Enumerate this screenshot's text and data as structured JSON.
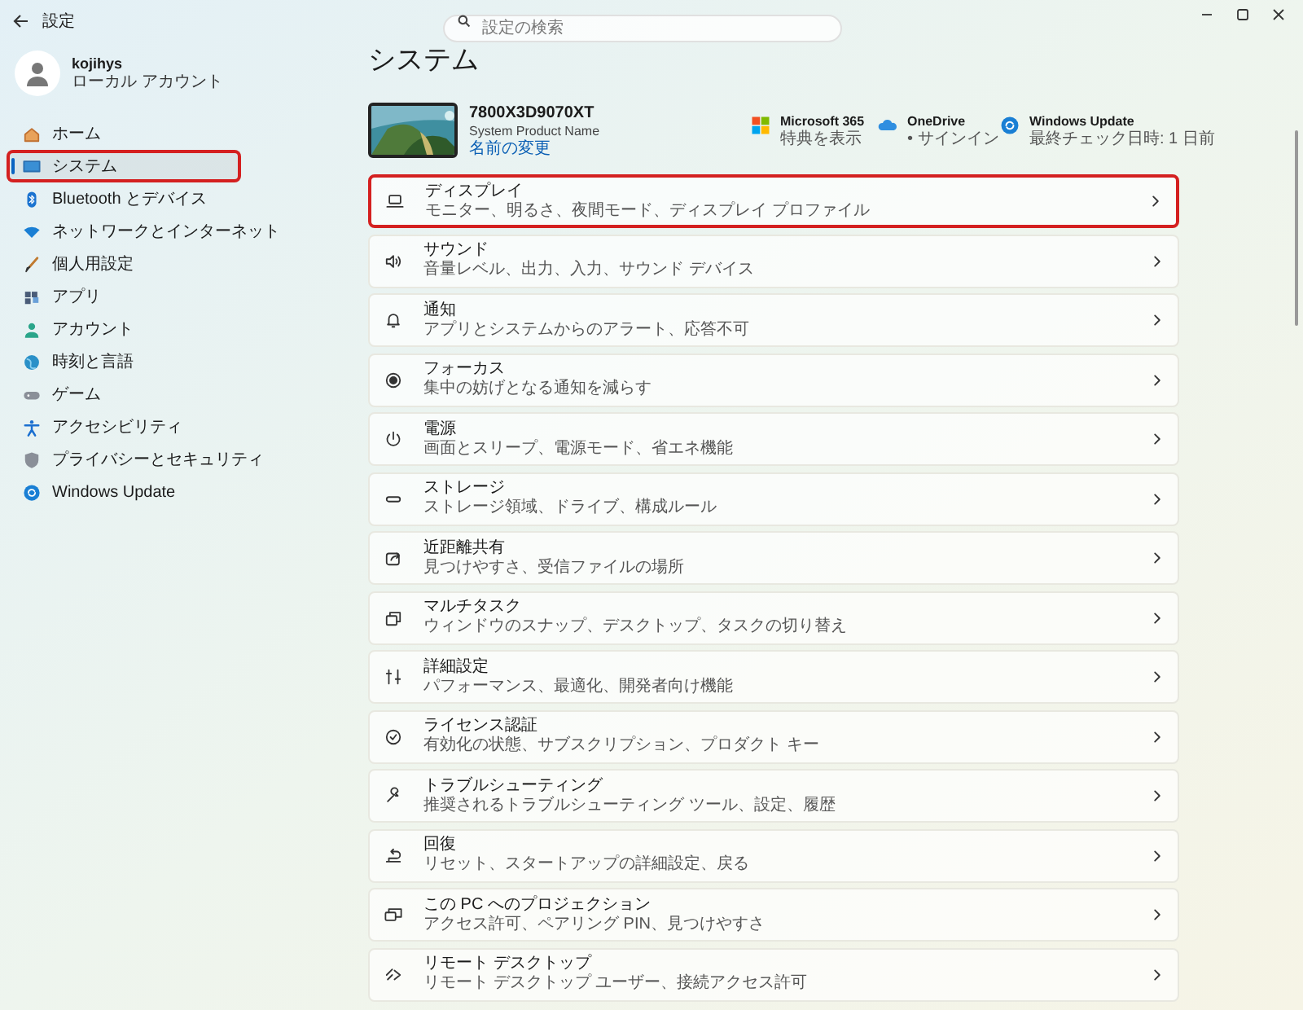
{
  "window": {
    "title": "設定",
    "search": {
      "placeholder": "設定の検索"
    }
  },
  "account": {
    "name": "kojihys",
    "type": "ローカル アカウント"
  },
  "sidebar": {
    "items": [
      {
        "label": "ホーム",
        "selected": false,
        "highlighted": false
      },
      {
        "label": "システム",
        "selected": true,
        "highlighted": true
      },
      {
        "label": "Bluetooth とデバイス",
        "selected": false,
        "highlighted": false
      },
      {
        "label": "ネットワークとインターネット",
        "selected": false,
        "highlighted": false
      },
      {
        "label": "個人用設定",
        "selected": false,
        "highlighted": false
      },
      {
        "label": "アプリ",
        "selected": false,
        "highlighted": false
      },
      {
        "label": "アカウント",
        "selected": false,
        "highlighted": false
      },
      {
        "label": "時刻と言語",
        "selected": false,
        "highlighted": false
      },
      {
        "label": "ゲーム",
        "selected": false,
        "highlighted": false
      },
      {
        "label": "アクセシビリティ",
        "selected": false,
        "highlighted": false
      },
      {
        "label": "プライバシーとセキュリティ",
        "selected": false,
        "highlighted": false
      },
      {
        "label": "Windows Update",
        "selected": false,
        "highlighted": false
      }
    ]
  },
  "page": {
    "title": "システム"
  },
  "device": {
    "name": "7800X3D9070XT",
    "model": "System Product Name",
    "rename_link": "名前の変更"
  },
  "services": [
    {
      "title": "Microsoft 365",
      "subtitle": "特典を表示"
    },
    {
      "title": "OneDrive",
      "subtitle": "• サインイン"
    },
    {
      "title": "Windows Update",
      "subtitle": "最終チェック日時: 1 日前"
    }
  ],
  "settings": [
    {
      "title": "ディスプレイ",
      "subtitle": "モニター、明るさ、夜間モード、ディスプレイ プロファイル",
      "highlighted": true
    },
    {
      "title": "サウンド",
      "subtitle": "音量レベル、出力、入力、サウンド デバイス",
      "highlighted": false
    },
    {
      "title": "通知",
      "subtitle": "アプリとシステムからのアラート、応答不可",
      "highlighted": false
    },
    {
      "title": "フォーカス",
      "subtitle": "集中の妨げとなる通知を減らす",
      "highlighted": false
    },
    {
      "title": "電源",
      "subtitle": "画面とスリープ、電源モード、省エネ機能",
      "highlighted": false
    },
    {
      "title": "ストレージ",
      "subtitle": "ストレージ領域、ドライブ、構成ルール",
      "highlighted": false
    },
    {
      "title": "近距離共有",
      "subtitle": "見つけやすさ、受信ファイルの場所",
      "highlighted": false
    },
    {
      "title": "マルチタスク",
      "subtitle": "ウィンドウのスナップ、デスクトップ、タスクの切り替え",
      "highlighted": false
    },
    {
      "title": "詳細設定",
      "subtitle": "パフォーマンス、最適化、開発者向け機能",
      "highlighted": false
    },
    {
      "title": "ライセンス認証",
      "subtitle": "有効化の状態、サブスクリプション、プロダクト キー",
      "highlighted": false
    },
    {
      "title": "トラブルシューティング",
      "subtitle": "推奨されるトラブルシューティング ツール、設定、履歴",
      "highlighted": false
    },
    {
      "title": "回復",
      "subtitle": "リセット、スタートアップの詳細設定、戻る",
      "highlighted": false
    },
    {
      "title": "この PC へのプロジェクション",
      "subtitle": "アクセス許可、ペアリング PIN、見つけやすさ",
      "highlighted": false
    },
    {
      "title": "リモート デスクトップ",
      "subtitle": "リモート デスクトップ ユーザー、接続アクセス許可",
      "highlighted": false
    }
  ]
}
